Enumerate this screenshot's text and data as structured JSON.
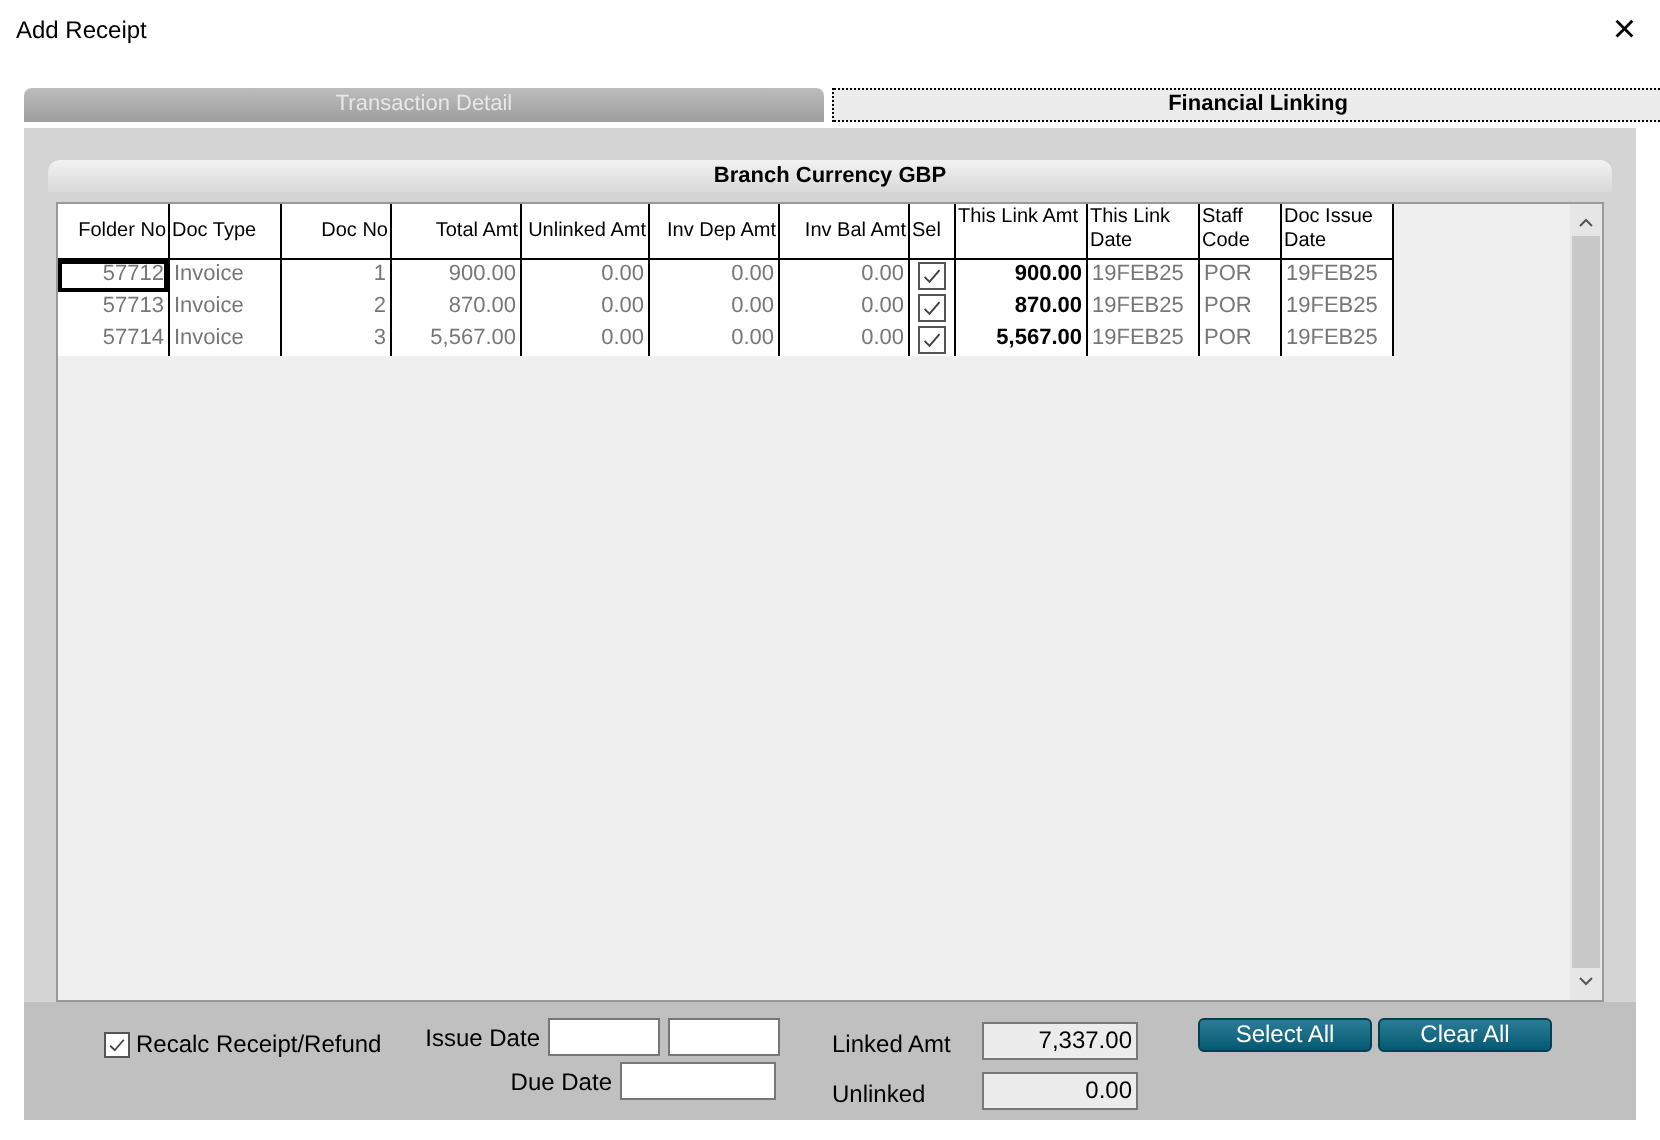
{
  "window": {
    "title": "Add Receipt",
    "close": "×"
  },
  "tabs": [
    {
      "label": "Transaction Detail",
      "selected": false
    },
    {
      "label": "Financial Linking",
      "selected": true
    }
  ],
  "panel_title": "Branch Currency GBP",
  "table": {
    "columns": [
      {
        "label": "Folder No",
        "kind": "text"
      },
      {
        "label": "Doc Type",
        "kind": "text"
      },
      {
        "label": "Doc No",
        "kind": "text"
      },
      {
        "label": "Total Amt",
        "kind": "text"
      },
      {
        "label": "Unlinked Amt",
        "kind": "text"
      },
      {
        "label": "Inv Dep Amt",
        "kind": "text"
      },
      {
        "label": "Inv Bal Amt",
        "kind": "text"
      },
      {
        "label": "Sel",
        "kind": "check"
      },
      {
        "label": "This Link Amt",
        "kind": "text"
      },
      {
        "label": "This Link Date",
        "kind": "text"
      },
      {
        "label": "Staff Code",
        "kind": "text"
      },
      {
        "label": "Doc Issue Date",
        "kind": "text"
      }
    ],
    "rows": [
      {
        "focused": true,
        "checked": true,
        "cells": [
          "57712",
          "Invoice",
          "1",
          "900.00",
          "0.00",
          "0.00",
          "0.00",
          "",
          "900.00",
          "19FEB25",
          "POR",
          "19FEB25"
        ]
      },
      {
        "focused": false,
        "checked": true,
        "cells": [
          "57713",
          "Invoice",
          "2",
          "870.00",
          "0.00",
          "0.00",
          "0.00",
          "",
          "870.00",
          "19FEB25",
          "POR",
          "19FEB25"
        ]
      },
      {
        "focused": false,
        "checked": true,
        "cells": [
          "57714",
          "Invoice",
          "3",
          "5,567.00",
          "0.00",
          "0.00",
          "0.00",
          "",
          "5,567.00",
          "19FEB25",
          "POR",
          "19FEB25"
        ]
      }
    ]
  },
  "recalc": {
    "label": "Recalc Receipt/Refund",
    "checked": true
  },
  "issue_date": {
    "label": "Issue Date"
  },
  "due_date": {
    "label": "Due Date"
  },
  "linked_amt": {
    "label": "Linked Amt",
    "value": "7,337.00"
  },
  "unlinked": {
    "label": "Unlinked",
    "value": "0.00"
  },
  "buttons": [
    "Select All",
    "Clear All"
  ]
}
